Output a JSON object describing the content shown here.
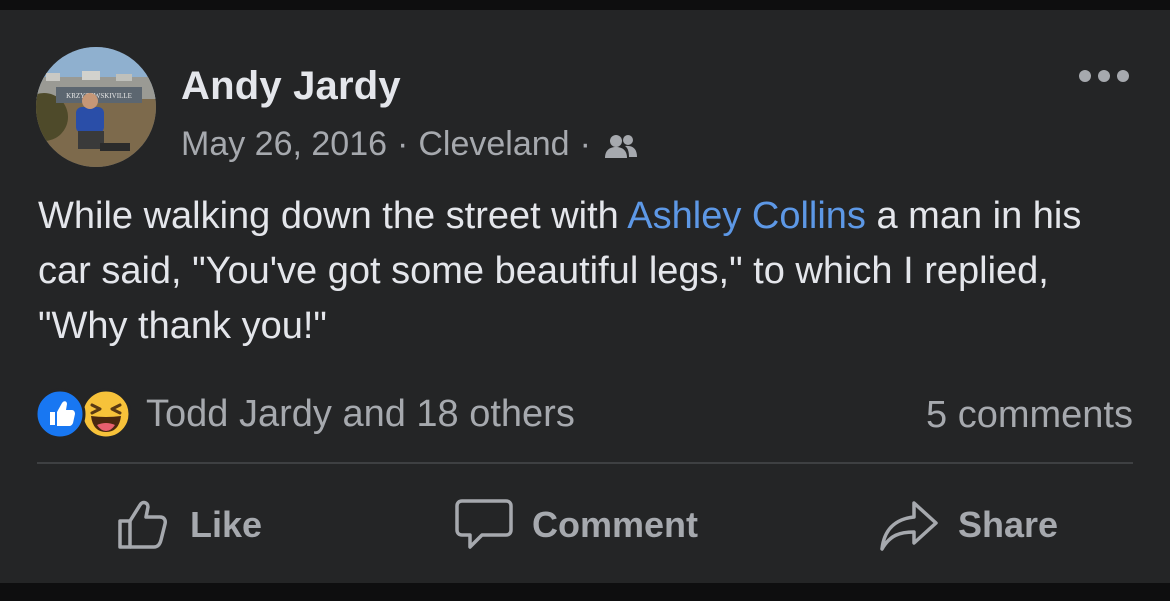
{
  "post": {
    "author": "Andy Jardy",
    "date": "May 26, 2016",
    "separator": "·",
    "location": "Cleveland",
    "audience_icon": "friends-icon",
    "more_icon": "more-options-icon",
    "avatar_sign_text": "KRZYZEWSKIVILLE",
    "text_before": "While walking down the street with ",
    "mention": "Ashley Collins",
    "text_after": " a man in his car said, \"You've got some beautiful legs,\" to which I replied, \"Why thank you!\""
  },
  "reactions": {
    "icons": [
      "like-reaction-icon",
      "haha-reaction-icon"
    ],
    "summary": "Todd Jardy and 18 others",
    "comments": "5 comments"
  },
  "actions": {
    "like": "Like",
    "comment": "Comment",
    "share": "Share"
  },
  "colors": {
    "background": "#242526",
    "primary_text": "#e4e6eb",
    "secondary_text": "#a6a9ae",
    "mention": "#5d98e6",
    "like_blue": "#1877f2",
    "haha_yellow": "#f7c23a"
  }
}
